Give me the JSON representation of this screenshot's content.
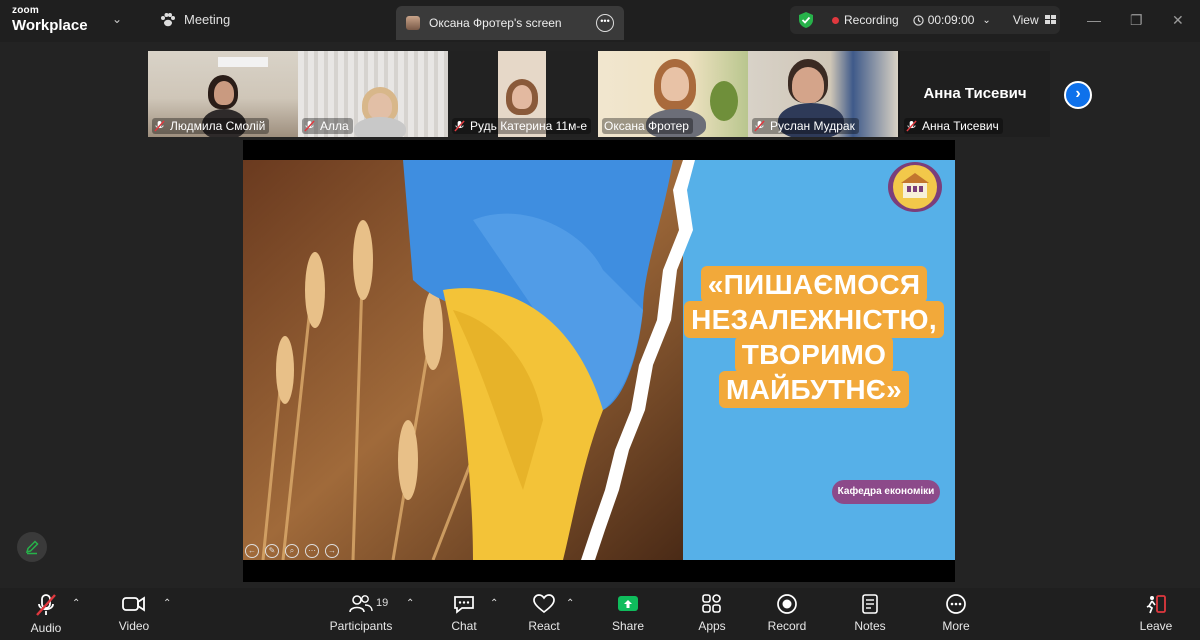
{
  "brand": {
    "small": "zoom",
    "big": "Workplace"
  },
  "header": {
    "meeting_label": "Meeting",
    "screen_tab_label": "Оксана Фротер's screen",
    "recording_label": "Recording",
    "timer": "00:09:00",
    "view_label": "View",
    "accent_green": "#27b24a",
    "record_red": "#e0383e"
  },
  "participants": [
    {
      "name": "Людмила Смолій",
      "muted": true
    },
    {
      "name": "Алла",
      "muted": true
    },
    {
      "name": "Рудь Катерина 11м-е",
      "muted": true
    },
    {
      "name": "Оксана Фротер",
      "muted": false,
      "active": true
    },
    {
      "name": "Руслан Мудрак",
      "muted": true
    },
    {
      "name": "Анна Тисевич",
      "muted": true,
      "video": false
    }
  ],
  "slide": {
    "slogan_lines": [
      "«ПИШАЄМОСЯ",
      "НЕЗАЛЕЖНІСТЮ,",
      "ТВОРИМО",
      "МАЙБУТНЄ»"
    ],
    "department": "Кафедра економіки",
    "sky_blue": "#56b0e8",
    "flag_yellow": "#f3c338",
    "label_orange": "#f2a93a"
  },
  "toolbar": {
    "audio": "Audio",
    "video": "Video",
    "participants": "Participants",
    "participants_count": "19",
    "chat": "Chat",
    "react": "React",
    "share": "Share",
    "apps": "Apps",
    "record": "Record",
    "notes": "Notes",
    "more": "More",
    "leave": "Leave",
    "share_green": "#0fbc5c"
  }
}
